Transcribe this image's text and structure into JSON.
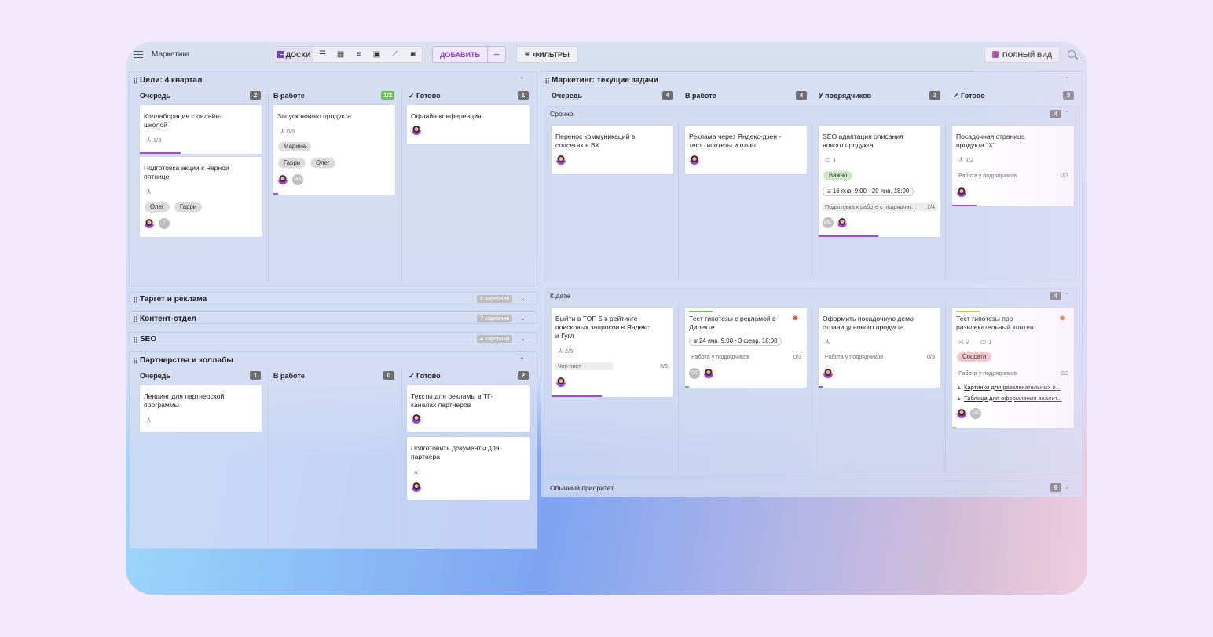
{
  "toolbar": {
    "title": "Маркетинг",
    "boards_label": "ДОСКИ",
    "add_label": "ДОБАВИТЬ",
    "filters_label": "ФИЛЬТРЫ",
    "full_view_label": "ПОЛНЫЙ ВИД"
  },
  "left": {
    "goals": {
      "title": "Цели: 4 квартал",
      "cols": [
        {
          "name": "Очередь",
          "count": "2"
        },
        {
          "name": "В работе",
          "count": "1/2"
        },
        {
          "name": "Готово",
          "count": "1"
        }
      ],
      "cards": {
        "c1": {
          "title": "Коллаборация с онлайн-школой",
          "sub": "1/3"
        },
        "c2": {
          "title": "Подготовка акции к Черной пятнице",
          "tags": [
            "Олег",
            "Гарри"
          ],
          "av": "Г"
        },
        "c3": {
          "title": "Запуск нового продукта",
          "sub": "0/5",
          "tags": [
            "Марина",
            "Гарри",
            "Олег"
          ],
          "av": "МА"
        },
        "c4": {
          "title": "Офлайн-конференция"
        }
      }
    },
    "target": {
      "title": "Таргет и реклама",
      "count": "6 карточек"
    },
    "content": {
      "title": "Контент-отдел",
      "count": "7 карточек"
    },
    "seo": {
      "title": "SEO",
      "count": "4 карточки"
    },
    "partners": {
      "title": "Партнерства и коллабы",
      "cols": [
        {
          "name": "Очередь",
          "count": "1"
        },
        {
          "name": "В работе",
          "count": "0"
        },
        {
          "name": "Готово",
          "count": "2"
        }
      ],
      "cards": {
        "p1": {
          "title": "Лендинг для партнерской программы"
        },
        "p2": {
          "title": "Тексты для рекламы в ТГ-каналах партнеров"
        },
        "p3": {
          "title": "Подготовить документы для партнера"
        }
      }
    }
  },
  "right": {
    "title": "Маркетинг: текущие задачи",
    "cols": [
      {
        "name": "Очередь",
        "count": "4"
      },
      {
        "name": "В работе",
        "count": "4"
      },
      {
        "name": "У подрядчиков",
        "count": "3"
      },
      {
        "name": "Готово",
        "count": "3"
      }
    ],
    "lanes": {
      "urgent": {
        "title": "Срочно",
        "count": "4"
      },
      "date": {
        "title": "К дате",
        "count": "4"
      },
      "normal": {
        "title": "Обычный приоритет",
        "count": "6"
      }
    },
    "cards": {
      "u1": {
        "title": "Перенос коммуникаций в соцсетях в ВК"
      },
      "u2": {
        "title": "Реклама через Яндекс-дзен - тест гипотезы и отчет"
      },
      "u3": {
        "title": "SEO адаптация описания нового продукта",
        "comments": "1",
        "tag": "Важно",
        "date": "16 янв. 9:00 - 20 янв. 18:00",
        "check": "Подготовка к работе с подрядчик...",
        "check_count": "2/4",
        "av": "ОС"
      },
      "u4": {
        "title": "Посадочная страница продукта \"Х\"",
        "sub": "1/2",
        "check": "Работа у подрядчиков",
        "check_count": "0/3"
      },
      "d1": {
        "title": "Выйти в ТОП 5 в рейтинге поисковых запросов в Яндекс и Гугл",
        "sub": "2/6",
        "check": "Чек-лист",
        "check_count": "3/6"
      },
      "d2": {
        "title": "Тест гипотезы с рекламой в Директе",
        "date": "24 янв. 9:00 - 3 февр. 18:00",
        "check": "Работа у подрядчиков",
        "check_count": "0/3",
        "av": "ОС"
      },
      "d3": {
        "title": "Оформить посадочную демо-страницу нового продукта",
        "check": "Работа у подрядчиков",
        "check_count": "0/3"
      },
      "d4": {
        "title": "Тест гипотезы про развлекательный контент",
        "views": "2",
        "comments": "1",
        "tag": "Соцсети",
        "check": "Работа у подрядчиков",
        "check_count": "0/3",
        "link1": "Картинки для развлекательных п...",
        "link2": "Таблица для оформления аналит...",
        "av": "ОС"
      }
    }
  },
  "colors": {
    "accent": "#8a3cc9",
    "progress_purple": "#a44ec6",
    "progress_green": "#6cc15a",
    "badge_gray": "#6f6f6f"
  }
}
